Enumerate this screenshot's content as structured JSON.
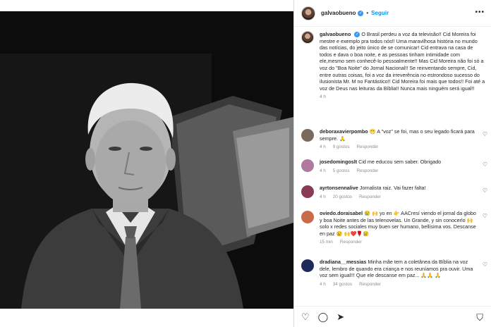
{
  "header": {
    "username": "galvaobueno",
    "verified_mark": "✓",
    "separator": "•",
    "follow_label": "Seguir",
    "more_icon": "•••"
  },
  "caption": {
    "username": "galvaobueno",
    "verified_mark": "✓",
    "text": "O Brasil perdeu a voz da televisão!! Cid Moreira foi mestre e exemplo pra todos nós!! Uma maravilhosa história no mundo das notícias, do jeito único de se comunicar! Cid entrava na casa de todos e dava o boa noite, e as pessoas tinham intimidade com ele,mesmo sem conhecê-lo pessoalmente!! Mas Cid Moreira não foi só a voz do \"Boa Noite\" do Jornal Nacional!! Se reinventando sempre, Cid, entre outras coisas, foi a voz da irreverência no estrondoso sucesso do ilusionista Mr. M no Fantástico!! Cid Moreira foi mais que todos!! Foi até a voz de Deus nas leituras da Bíblia!! Nunca mais ninguém será igual!!",
    "time": "4 h"
  },
  "comments": [
    {
      "username": "deboraxavierpombo",
      "text": "😁 A \"voz\" se foi, mas o seu legado ficará para sempre. 🙏",
      "time": "4 h",
      "likes": "9 gostos",
      "reply": "Responder",
      "avatar_color": "#7a6a5c"
    },
    {
      "username": "josedomingoslt",
      "text": "Cid me educou sem saber. Obrigado",
      "time": "4 h",
      "likes": "5 gostos",
      "reply": "Responder",
      "avatar_color": "#b07aa0"
    },
    {
      "username": "ayrtonsennalive",
      "text": "Jornalista raiz. Vai fazer falta!",
      "time": "4 h",
      "likes": "20 gostos",
      "reply": "Responder",
      "avatar_color": "#8a3a52"
    },
    {
      "username": "oviedo.doraisabel",
      "text": "😢 🙌 yo en 👉 AACresí viendo el jornal da globo y boa Noite antes de las telenovelas. Un Grande, y sin conocerlo 🙌 solo x redes sociales muy buen ser humano, bellísima vos. Descanse en paz 😢",
      "tail": "🙌❤️🌹😢",
      "time": "15 min",
      "likes": "",
      "reply": "Responder",
      "avatar_color": "#c96a4a"
    },
    {
      "username": "dradiana__messias",
      "text": "Minha mãe tem a coletânea da Bíblia na voz dele, lembro de quando era criança e nos reuníamos pra ouvir. Uma voz sem igual!!! Que ele descanse em paz... 🙏🙏",
      "tail": "🙏",
      "time": "4 h",
      "likes": "34 gostos",
      "reply": "Responder",
      "avatar_color": "#1e2a5a"
    }
  ],
  "actions": {
    "like_icon": "♡",
    "comment_icon": "◯",
    "share_icon": "➤",
    "save_icon": "⛉"
  },
  "icons": {
    "heart_small": "♡"
  }
}
